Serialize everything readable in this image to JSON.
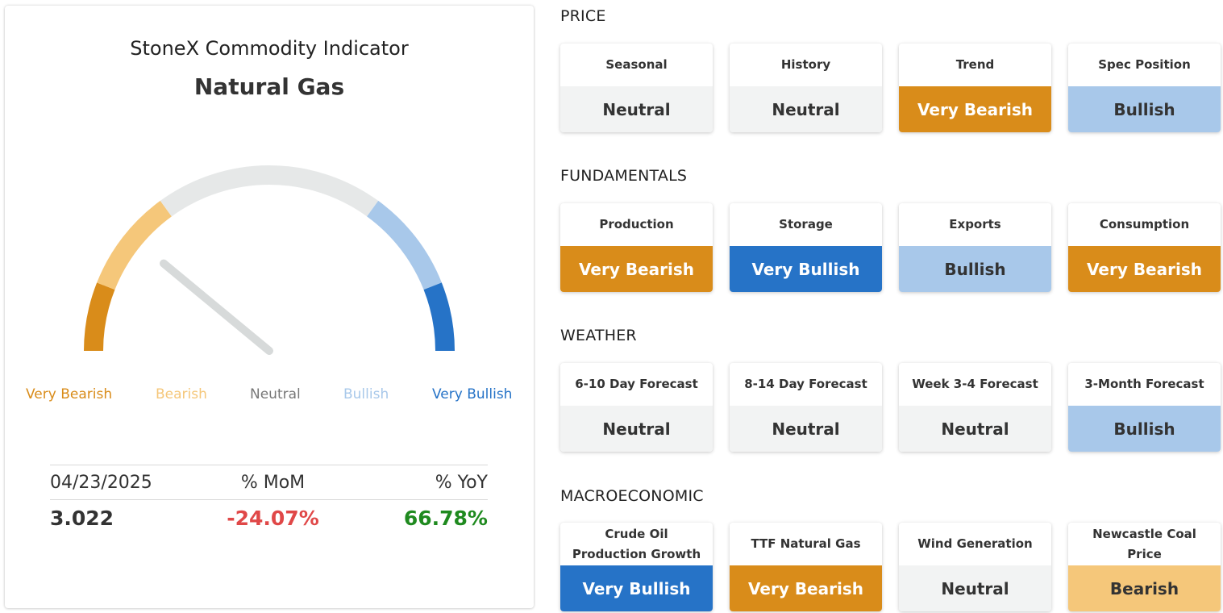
{
  "indicator": {
    "title": "StoneX Commodity Indicator",
    "commodity": "Natural Gas",
    "needle_value_fraction": 0.22,
    "scale_labels": [
      {
        "label": "Very Bearish",
        "color": "#d98c1a"
      },
      {
        "label": "Bearish",
        "color": "#f5c77a"
      },
      {
        "label": "Neutral",
        "color": "#777777"
      },
      {
        "label": "Bullish",
        "color": "#a8c8ea"
      },
      {
        "label": "Very Bullish",
        "color": "#2673c7"
      }
    ],
    "stats": {
      "date_label": "04/23/2025",
      "mom_label": "% MoM",
      "yoy_label": "% YoY",
      "price": "3.022",
      "mom_value": "-24.07%",
      "yoy_value": "66.78%",
      "mom_color": "#e04848",
      "yoy_color": "#1f8a1f"
    }
  },
  "colors": {
    "very_bearish": "#d98c1a",
    "bearish": "#f5c77a",
    "neutral_bg": "#f2f3f3",
    "bullish": "#a8c8ea",
    "very_bullish": "#2673c7",
    "gauge_neutral": "#e6e8e8",
    "needle": "#d7dada"
  },
  "sections": [
    {
      "title": "PRICE",
      "tiles": [
        {
          "name": "Seasonal",
          "value": "Neutral"
        },
        {
          "name": "History",
          "value": "Neutral"
        },
        {
          "name": "Trend",
          "value": "Very Bearish"
        },
        {
          "name": "Spec Position",
          "value": "Bullish"
        }
      ]
    },
    {
      "title": "FUNDAMENTALS",
      "tiles": [
        {
          "name": "Production",
          "value": "Very Bearish"
        },
        {
          "name": "Storage",
          "value": "Very Bullish"
        },
        {
          "name": "Exports",
          "value": "Bullish"
        },
        {
          "name": "Consumption",
          "value": "Very Bearish"
        }
      ]
    },
    {
      "title": "WEATHER",
      "tiles": [
        {
          "name": "6-10 Day Forecast",
          "value": "Neutral"
        },
        {
          "name": "8-14 Day Forecast",
          "value": "Neutral"
        },
        {
          "name": "Week 3-4 Forecast",
          "value": "Neutral"
        },
        {
          "name": "3-Month Forecast",
          "value": "Bullish"
        }
      ]
    },
    {
      "title": "MACROECONOMIC",
      "tiles": [
        {
          "name": "Crude Oil Production Growth",
          "value": "Very Bullish"
        },
        {
          "name": "TTF Natural Gas",
          "value": "Very Bearish"
        },
        {
          "name": "Wind Generation",
          "value": "Neutral"
        },
        {
          "name": "Newcastle Coal Price",
          "value": "Bearish"
        }
      ]
    }
  ]
}
